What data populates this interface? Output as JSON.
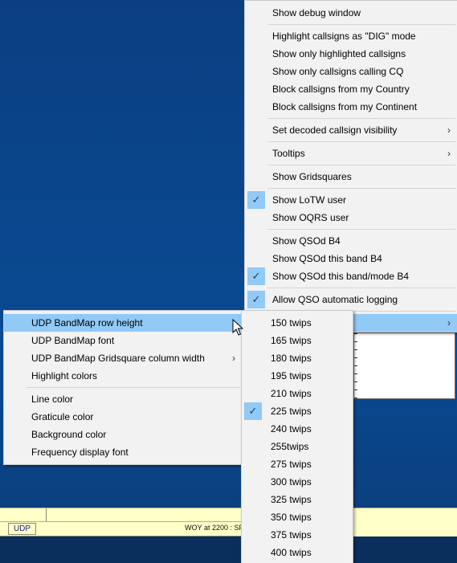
{
  "main_menu": {
    "items": [
      {
        "label": "Show debug window",
        "checked": false,
        "submenu": false
      },
      {
        "sep": true
      },
      {
        "label": "Highlight callsigns as \"DIG\" mode",
        "checked": false,
        "submenu": false
      },
      {
        "label": "Show only highlighted callsigns",
        "checked": false,
        "submenu": false
      },
      {
        "label": "Show only callsigns calling CQ",
        "checked": false,
        "submenu": false
      },
      {
        "label": "Block callsigns from my Country",
        "checked": false,
        "submenu": false
      },
      {
        "label": "Block callsigns from my Continent",
        "checked": false,
        "submenu": false
      },
      {
        "sep": true
      },
      {
        "label": "Set decoded callsign visibility",
        "checked": false,
        "submenu": true
      },
      {
        "sep": true
      },
      {
        "label": "Tooltips",
        "checked": false,
        "submenu": true
      },
      {
        "sep": true
      },
      {
        "label": "Show Gridsquares",
        "checked": false,
        "submenu": false
      },
      {
        "sep": true
      },
      {
        "label": "Show LoTW user",
        "checked": true,
        "submenu": false
      },
      {
        "label": "Show OQRS user",
        "checked": false,
        "submenu": false
      },
      {
        "sep": true
      },
      {
        "label": "Show QSOd B4",
        "checked": false,
        "submenu": false
      },
      {
        "label": "Show QSOd this band B4",
        "checked": false,
        "submenu": false
      },
      {
        "label": "Show QSOd this band/mode B4",
        "checked": true,
        "submenu": false
      },
      {
        "sep": true
      },
      {
        "label": "Allow QSO automatic logging",
        "checked": true,
        "submenu": false
      },
      {
        "sep": true
      },
      {
        "label": "",
        "checked": false,
        "submenu": true,
        "highlighted": true
      }
    ]
  },
  "settings_menu": {
    "items": [
      {
        "label": "UDP BandMap row height",
        "submenu": true,
        "highlighted": true
      },
      {
        "label": "UDP BandMap font",
        "submenu": false
      },
      {
        "label": "UDP BandMap Gridsquare column width",
        "submenu": true
      },
      {
        "label": "Highlight colors",
        "submenu": false
      },
      {
        "sep": true
      },
      {
        "label": "Line color",
        "submenu": false
      },
      {
        "label": "Graticule color",
        "submenu": false
      },
      {
        "label": "Background color",
        "submenu": false
      },
      {
        "label": "Frequency display font",
        "submenu": false
      }
    ]
  },
  "row_height_menu": {
    "items": [
      {
        "label": "150 twips",
        "checked": false
      },
      {
        "label": "165 twips",
        "checked": false
      },
      {
        "label": "180 twips",
        "checked": false
      },
      {
        "label": "195 twips",
        "checked": false
      },
      {
        "label": "210 twips",
        "checked": false
      },
      {
        "label": "225 twips",
        "checked": true
      },
      {
        "label": "240 twips",
        "checked": false
      },
      {
        "label": "255twips",
        "checked": false
      },
      {
        "label": "275 twips",
        "checked": false
      },
      {
        "label": "300 twips",
        "checked": false
      },
      {
        "label": "325 twips",
        "checked": false
      },
      {
        "label": "350 twips",
        "checked": false
      },
      {
        "label": "375 twips",
        "checked": false
      },
      {
        "label": "400 twips",
        "checked": false
      }
    ]
  },
  "status": {
    "mode_label": "UDP",
    "info_text": "WOY at 2200 : SF"
  },
  "icons": {
    "check": "✓",
    "submenu_arrow": "›"
  },
  "colors": {
    "desktop_bg": "#0a4a8e",
    "menu_bg": "#f2f2f2",
    "highlight": "#91c9f7",
    "status_bg": "#ffffc8"
  }
}
